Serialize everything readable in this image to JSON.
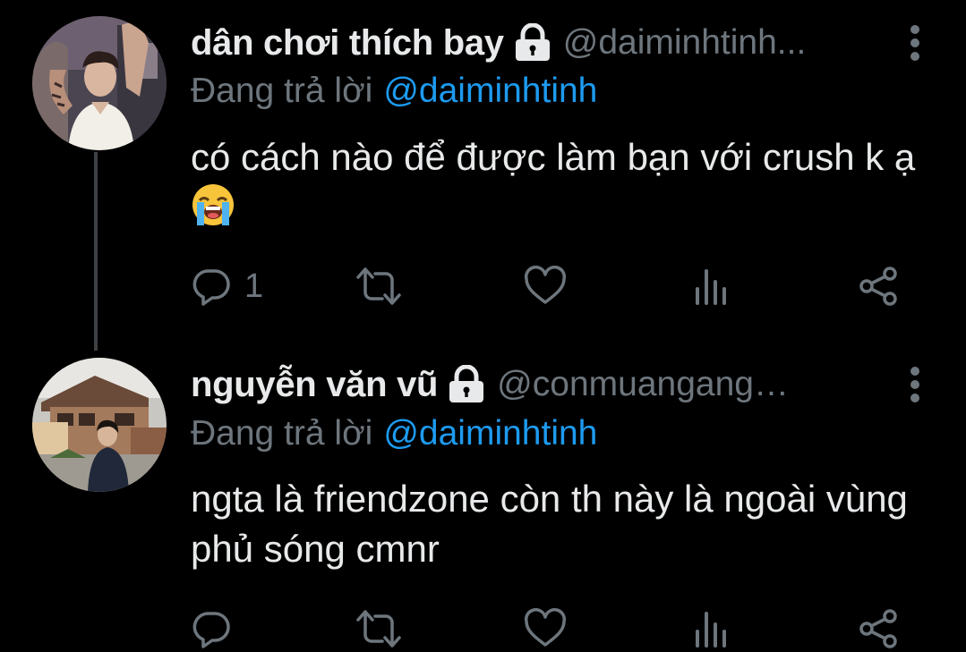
{
  "colors": {
    "background": "#000000",
    "primary_text": "#e7e9ea",
    "secondary_text": "#6e767d",
    "mention": "#1d9bf0",
    "thread_line": "#3e4144"
  },
  "replies": [
    {
      "display_name": "dân chơi thích bay",
      "protected_icon": "lock-icon",
      "handle": "@daiminhtinh...",
      "reply_prefix": "Đang trả lời",
      "reply_mention": "@daiminhtinh",
      "text": "có cách nào để được làm bạn với crush k ạ",
      "emoji": "loudly-crying-face",
      "reply_count": "1",
      "actions": [
        "reply-icon",
        "retweet-icon",
        "like-icon",
        "analytics-icon",
        "share-icon"
      ]
    },
    {
      "display_name": "nguyễn văn vũ",
      "protected_icon": "lock-icon",
      "handle": "@conmuangangq...",
      "reply_prefix": "Đang trả lời",
      "reply_mention": "@daiminhtinh",
      "text": "ngta là friendzone còn th này là ngoài vùng phủ sóng cmnr",
      "emoji": "",
      "reply_count": "",
      "actions": [
        "reply-icon",
        "retweet-icon",
        "like-icon",
        "analytics-icon",
        "share-icon"
      ]
    }
  ]
}
